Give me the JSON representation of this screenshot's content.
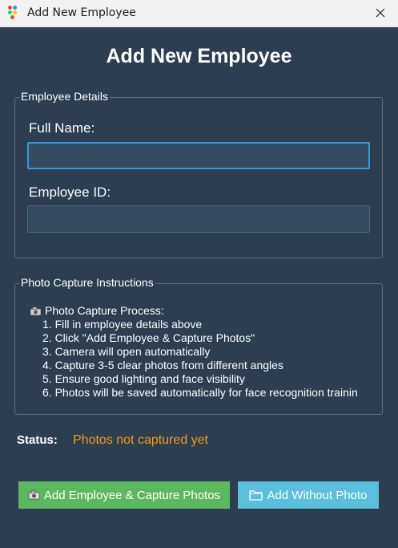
{
  "window": {
    "title": "Add New Employee"
  },
  "heading": "Add New Employee",
  "details": {
    "legend": "Employee Details",
    "full_name_label": "Full Name:",
    "full_name_value": "",
    "employee_id_label": "Employee ID:",
    "employee_id_value": ""
  },
  "instructions": {
    "legend": "Photo Capture Instructions",
    "heading": "Photo Capture Process:",
    "steps": [
      "1. Fill in employee details above",
      "2. Click \"Add Employee & Capture Photos\"",
      "3. Camera will open automatically",
      "4. Capture 3-5 clear photos from different angles",
      "5. Ensure good lighting and face visibility",
      "6. Photos will be saved automatically for face recognition trainin"
    ]
  },
  "status": {
    "label": "Status:",
    "value": "Photos not captured yet",
    "color": "#f39c12"
  },
  "buttons": {
    "capture_label": "Add Employee & Capture Photos",
    "capture_icon": "camera-icon",
    "without_photo_label": "Add Without Photo",
    "without_photo_icon": "folder-icon"
  },
  "colors": {
    "background": "#2c3e50",
    "green": "#5cb85c",
    "blue": "#5bc0de",
    "focus": "#3498db"
  }
}
